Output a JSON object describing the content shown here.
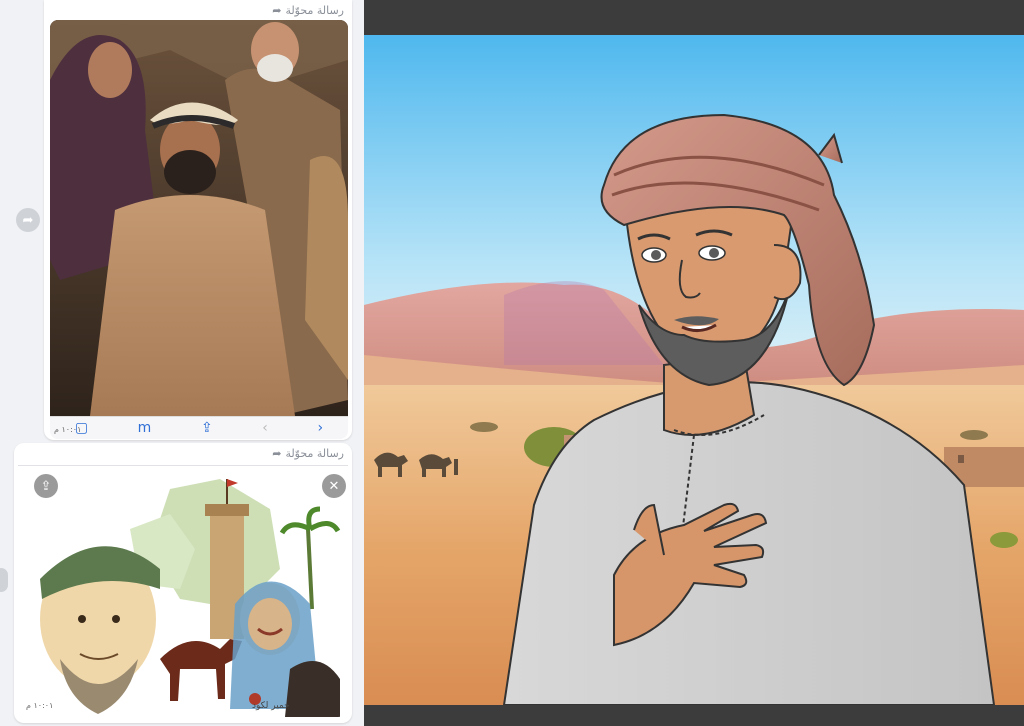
{
  "chat": {
    "bubble1": {
      "forward_label": "رسالة محوّلة",
      "timestamp": "١٠:٠١ م",
      "photo_alt": "photo-of-actors"
    },
    "bubble2": {
      "forward_label": "رسالة محوّلة",
      "timestamp": "١٠:٠١ م",
      "sketch_signature": "حمير لكود"
    },
    "browser_bar": {
      "icons": [
        "book-icon",
        "share-icon",
        "back-icon",
        "forward-icon"
      ]
    }
  },
  "colors": {
    "chat_bg": "#f1f2f5",
    "bubble_bg": "#ffffff",
    "link_blue": "#2f6fd6",
    "sky_top": "#4fb8ee",
    "sand": "#e2a169",
    "viewer_bar": "#3c3c3c"
  }
}
